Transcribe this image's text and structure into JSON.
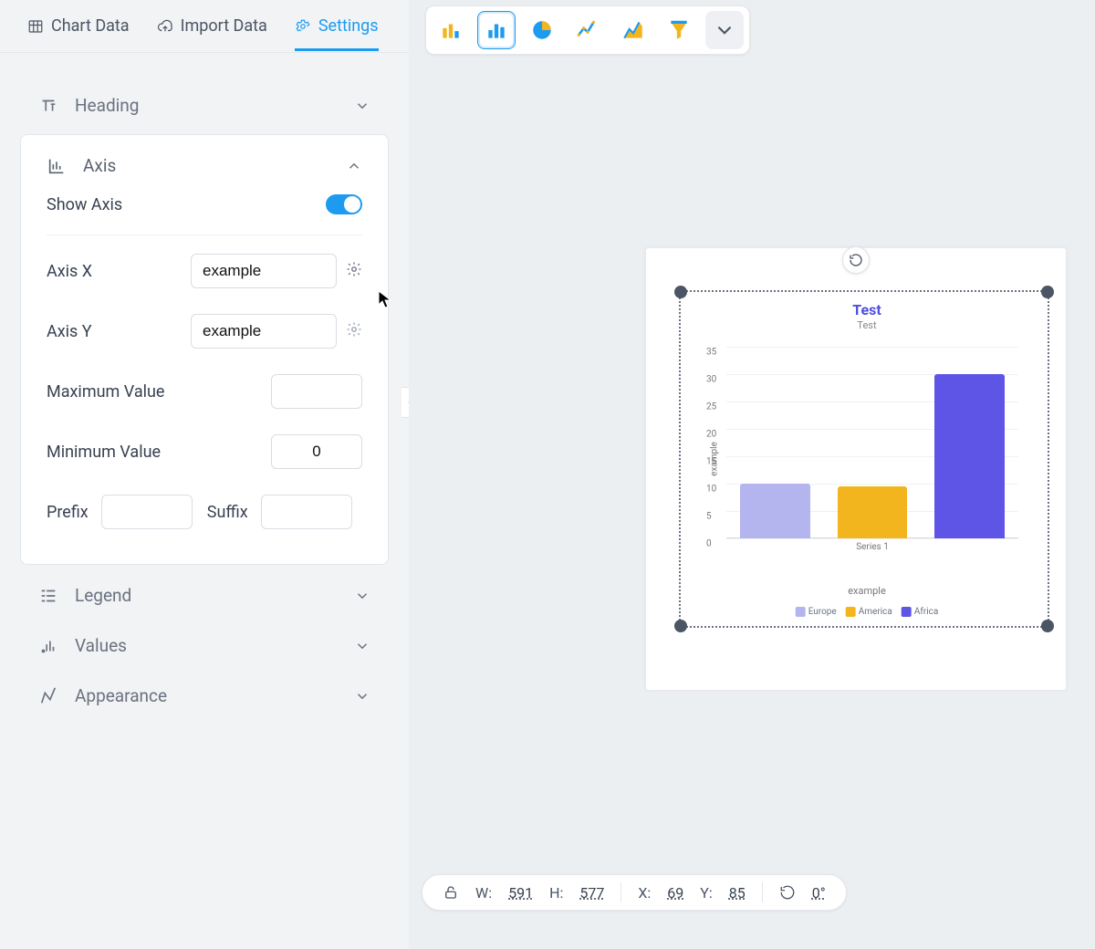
{
  "tabs": {
    "chart_data": "Chart Data",
    "import_data": "Import Data",
    "settings": "Settings"
  },
  "sections": {
    "heading": "Heading",
    "axis": "Axis",
    "legend": "Legend",
    "values": "Values",
    "appearance": "Appearance"
  },
  "axis": {
    "show_axis_label": "Show Axis",
    "show_axis_on": true,
    "x_label": "Axis X",
    "x_value": "example",
    "y_label": "Axis Y",
    "y_value": "example",
    "max_label": "Maximum Value",
    "max_value": "",
    "min_label": "Minimum Value",
    "min_value": "0",
    "prefix_label": "Prefix",
    "prefix_value": "",
    "suffix_label": "Suffix",
    "suffix_value": ""
  },
  "status": {
    "w_label": "W:",
    "w": "591",
    "h_label": "H:",
    "h": "577",
    "x_label": "X:",
    "x": "69",
    "y_label": "Y:",
    "y": "85",
    "rot": "0°"
  },
  "colors": {
    "europe": "#b4b4ef",
    "america": "#f3b51e",
    "africa": "#5e54e6"
  },
  "chart_data": {
    "type": "bar",
    "title": "Test",
    "subtitle": "Test",
    "xlabel": "example",
    "ylabel": "example",
    "categories": [
      "Series 1"
    ],
    "series": [
      {
        "name": "Europe",
        "values": [
          10
        ]
      },
      {
        "name": "America",
        "values": [
          9.5
        ]
      },
      {
        "name": "Africa",
        "values": [
          30
        ]
      }
    ],
    "yticks": [
      0,
      5,
      10,
      15,
      20,
      25,
      30,
      35
    ],
    "ylim": [
      0,
      35
    ]
  }
}
